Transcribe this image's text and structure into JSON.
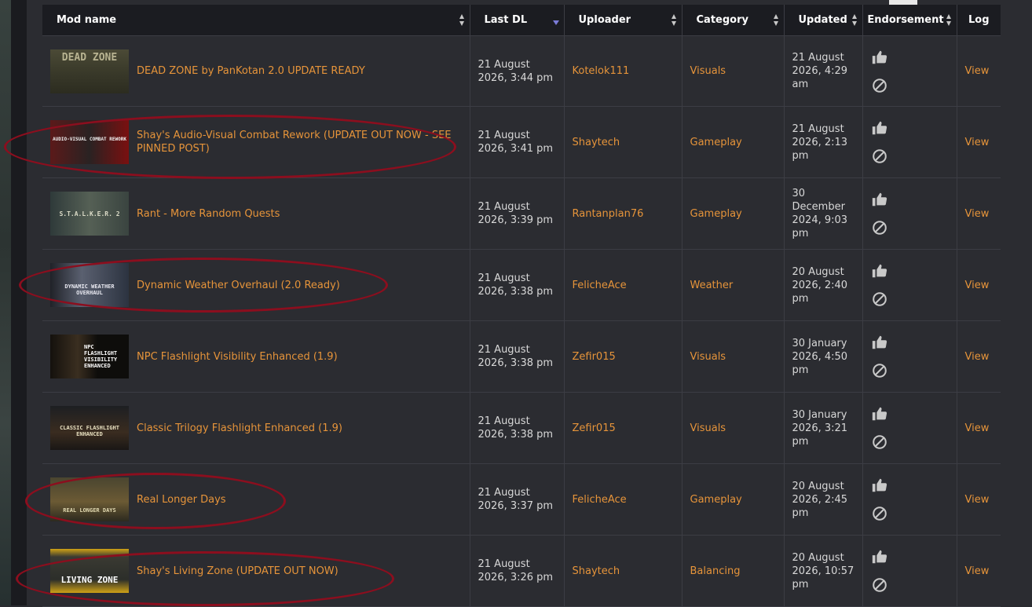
{
  "columns": {
    "mod_name": "Mod name",
    "last_dl": "Last DL",
    "uploader": "Uploader",
    "category": "Category",
    "updated": "Updated",
    "endorsement": "Endorsement",
    "log": "Log"
  },
  "rows": [
    {
      "mod": "DEAD ZONE by PanKotan 2.0 UPDATE READY",
      "thumb_text": "DEAD ZONE",
      "last_dl": "21 August 2026, 3:44 pm",
      "uploader": "Kotelok111",
      "category": "Visuals",
      "updated": "21 August 2026, 4:29 am",
      "log": "View"
    },
    {
      "mod": "Shay's Audio-Visual Combat Rework (UPDATE OUT NOW - SEE PINNED POST)",
      "thumb_text": "AUDIO-VISUAL COMBAT REWORK",
      "last_dl": "21 August 2026, 3:41 pm",
      "uploader": "Shaytech",
      "category": "Gameplay",
      "updated": "21 August 2026, 2:13 pm",
      "log": "View"
    },
    {
      "mod": "Rant - More Random Quests",
      "thumb_text": "S.T.A.L.K.E.R. 2",
      "last_dl": "21 August 2026, 3:39 pm",
      "uploader": "Rantanplan76",
      "category": "Gameplay",
      "updated": "30 December 2024, 9:03 pm",
      "log": "View"
    },
    {
      "mod": "Dynamic Weather Overhaul (2.0 Ready)",
      "thumb_text": "DYNAMIC WEATHER OVERHAUL",
      "last_dl": "21 August 2026, 3:38 pm",
      "uploader": "FelicheAce",
      "category": "Weather",
      "updated": "20 August 2026, 2:40 pm",
      "log": "View"
    },
    {
      "mod": "NPC Flashlight Visibility Enhanced (1.9)",
      "thumb_text": "NPC FLASHLIGHT VISIBILITY ENHANCED",
      "last_dl": "21 August 2026, 3:38 pm",
      "uploader": "Zefir015",
      "category": "Visuals",
      "updated": "30 January 2026, 4:50 pm",
      "log": "View"
    },
    {
      "mod": "Classic Trilogy Flashlight Enhanced (1.9)",
      "thumb_text": "CLASSIC FLASHLIGHT ENHANCED",
      "last_dl": "21 August 2026, 3:38 pm",
      "uploader": "Zefir015",
      "category": "Visuals",
      "updated": "30 January 2026, 3:21 pm",
      "log": "View"
    },
    {
      "mod": "Real Longer Days",
      "thumb_text": "REAL LONGER DAYS",
      "last_dl": "21 August 2026, 3:37 pm",
      "uploader": "FelicheAce",
      "category": "Gameplay",
      "updated": "20 August 2026, 2:45 pm",
      "log": "View"
    },
    {
      "mod": "Shay's Living Zone (UPDATE OUT NOW)",
      "thumb_text": "LIVING ZONE",
      "last_dl": "21 August 2026, 3:26 pm",
      "uploader": "Shaytech",
      "category": "Balancing",
      "updated": "20 August 2026, 10:57 pm",
      "log": "View"
    }
  ],
  "colors": {
    "link": "#e6943a",
    "header_bg": "#1b1c21",
    "row_bg": "#2b2c31",
    "annotation": "#8c0e1e"
  },
  "icons": {
    "endorse": "thumbs-up-icon",
    "abstain": "no-sign-icon"
  }
}
